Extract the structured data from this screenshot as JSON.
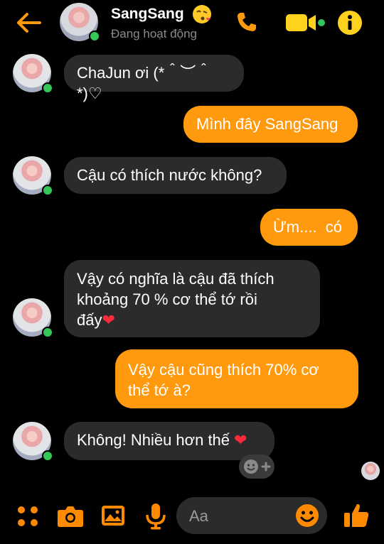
{
  "header": {
    "contact_name": "SangSang",
    "status": "Đang hoạt động"
  },
  "colors": {
    "accent": "#ff9a0e",
    "incoming_bubble": "#2b2b2b",
    "online": "#35c65a",
    "heart": "#ff2a3a"
  },
  "messages": [
    {
      "from": "them",
      "text": "ChaJun ơi (*＾︶＾*)♡"
    },
    {
      "from": "me",
      "text": "Mình đây SangSang"
    },
    {
      "from": "them",
      "text": "Cậu có thích nước không?"
    },
    {
      "from": "me",
      "text": "Ừm....  có"
    },
    {
      "from": "them",
      "text_line1": "Vậy có nghĩa là cậu đã thích",
      "text_line2": "khoảng 70 % cơ thể tớ rồi",
      "text_line3": "đấy",
      "heart": "❤"
    },
    {
      "from": "me",
      "text_line1": "Vậy cậu cũng thích 70% cơ",
      "text_line2": "thể tớ à?"
    },
    {
      "from": "them",
      "text": "Không! Nhiều hơn thế",
      "heart": "❤"
    }
  ],
  "composer": {
    "placeholder": "Aa"
  },
  "icons": {
    "back": "back-arrow-icon",
    "call": "phone-icon",
    "video": "video-camera-icon",
    "info": "info-icon",
    "apps": "apps-grid-icon",
    "camera": "camera-icon",
    "gallery": "image-icon",
    "mic": "microphone-icon",
    "emoji": "emoji-icon",
    "like": "thumbs-up-icon",
    "react": "add-reaction-icon"
  }
}
